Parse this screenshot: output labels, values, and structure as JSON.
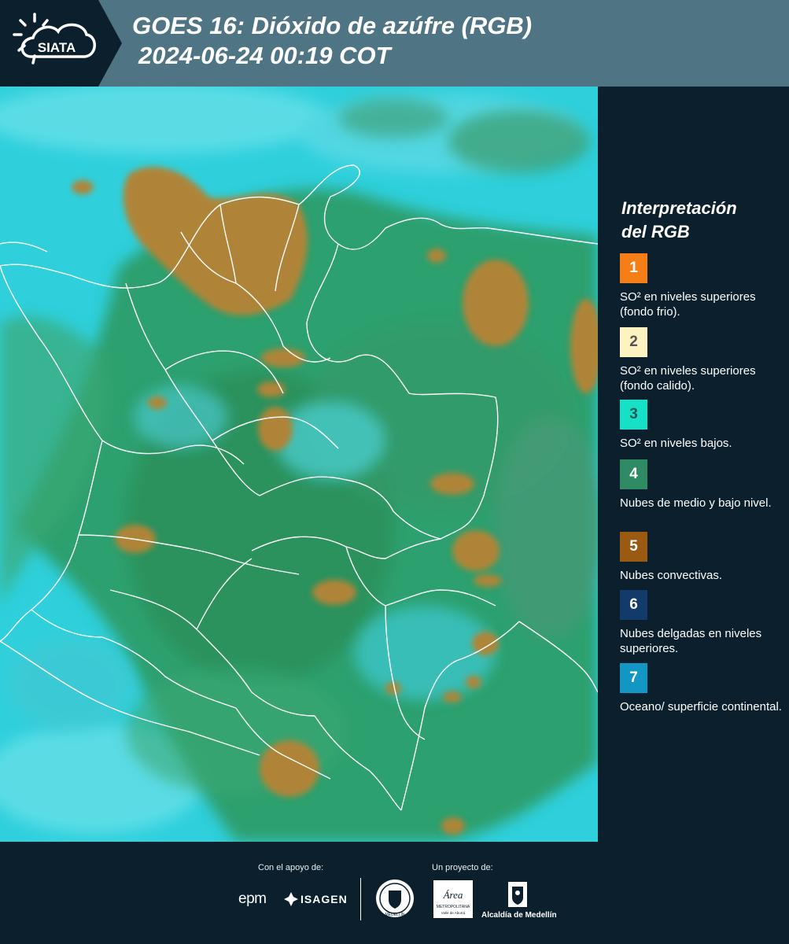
{
  "header": {
    "logo_text": "SIATA",
    "title_line1": "GOES 16: Dióxido de azúfre (RGB)",
    "title_line2": "2024-06-24 00:19 COT"
  },
  "map": {
    "layer": "RGB",
    "colors": {
      "ocean": "#2fd0dc",
      "green": "#2f9a62",
      "convective": "#b08439",
      "border": "#ffffff"
    }
  },
  "legend": {
    "title_line1": "Interpretación",
    "title_line2": "del RGB",
    "items": [
      {
        "number": "1",
        "color": "#f57e17",
        "text_color": "#ffffff",
        "label": "SO² en niveles superiores (fondo frio)."
      },
      {
        "number": "2",
        "color": "#fdf3c0",
        "text_color": "#555555",
        "label": "SO² en niveles superiores (fondo calido)."
      },
      {
        "number": "3",
        "color": "#17e0c6",
        "text_color": "#1a5a55",
        "label": "SO² en niveles bajos."
      },
      {
        "number": "4",
        "color": "#2f8b64",
        "text_color": "#ffffff",
        "label": "Nubes de medio y bajo nivel."
      },
      {
        "number": "5",
        "color": "#9a5a12",
        "text_color": "#ffffff",
        "label": "Nubes convectivas."
      },
      {
        "number": "6",
        "color": "#123a6a",
        "text_color": "#ffffff",
        "label": "Nubes delgadas en niveles superiores."
      },
      {
        "number": "7",
        "color": "#1296c4",
        "text_color": "#ffffff",
        "label": "Oceano/ superficie continental."
      }
    ]
  },
  "footer": {
    "support_label": "Con el apoyo de:",
    "project_label": "Un proyecto de:",
    "logo_epm": "epm",
    "logo_isagen": "ISAGEN",
    "logo_area_title": "Área",
    "logo_area_sub1": "METROPOLITANA",
    "logo_area_sub2": "Valle de Aburrá",
    "logo_alcaldia": "Alcaldía de Medellín",
    "logo_medellin_seal": "MEDELLÍN"
  }
}
